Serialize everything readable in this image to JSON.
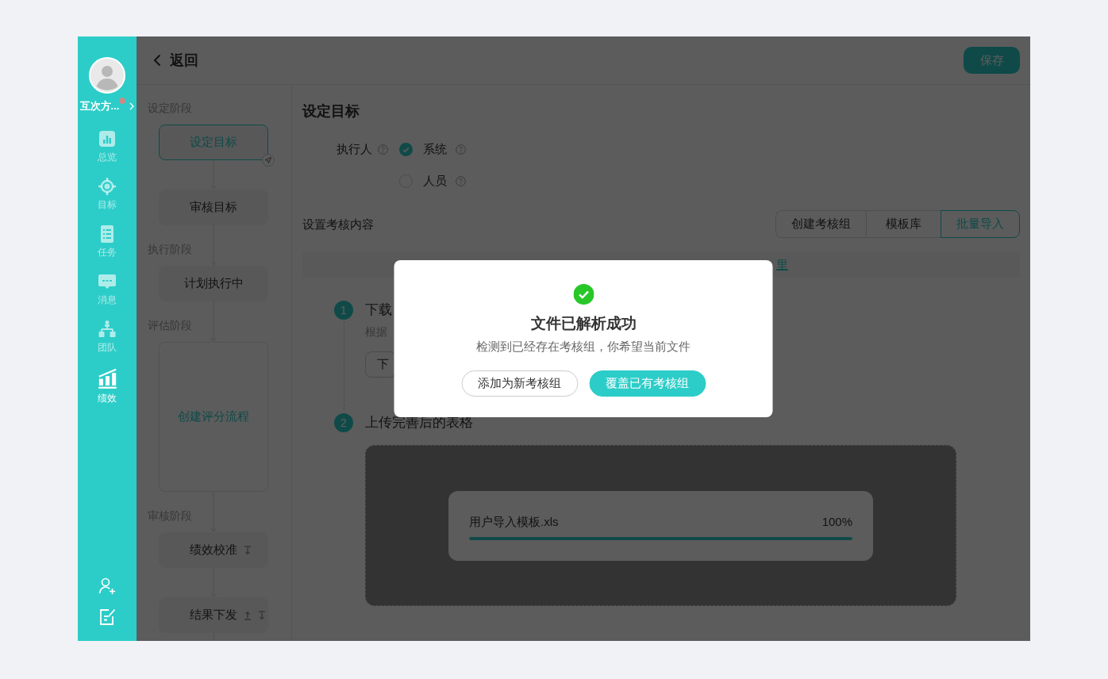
{
  "sidebar": {
    "user": {
      "name": "互次方...",
      "unread": true
    },
    "nav": [
      {
        "kind": "overview",
        "label": "总览",
        "selected": false
      },
      {
        "kind": "goals",
        "label": "目标",
        "selected": false
      },
      {
        "kind": "tasks",
        "label": "任务",
        "selected": false
      },
      {
        "kind": "messages",
        "label": "消息",
        "selected": false
      },
      {
        "kind": "team",
        "label": "团队",
        "selected": false
      },
      {
        "kind": "performance",
        "label": "绩效",
        "selected": true
      }
    ]
  },
  "header": {
    "back": "返回",
    "save": "保存"
  },
  "flow": {
    "stages": [
      {
        "label": "设定阶段",
        "steps": [
          {
            "kind": "step",
            "label": "设定目标",
            "selected": true,
            "can_move_up": false,
            "can_move_down": false
          },
          {
            "kind": "step",
            "label": "审核目标",
            "selected": false,
            "can_move_up": false,
            "can_move_down": false
          }
        ]
      },
      {
        "label": "执行阶段",
        "steps": [
          {
            "kind": "step",
            "label": "计划执行中",
            "selected": false,
            "can_move_up": false,
            "can_move_down": false
          }
        ]
      },
      {
        "label": "评估阶段",
        "steps": [
          {
            "kind": "group",
            "label": "创建评分流程",
            "selected": false
          }
        ]
      },
      {
        "label": "审核阶段",
        "steps": [
          {
            "kind": "step",
            "label": "绩效校准",
            "selected": false,
            "can_move_up": false,
            "can_move_down": true
          },
          {
            "kind": "step",
            "label": "结果下发",
            "selected": false,
            "can_move_up": true,
            "can_move_down": true
          }
        ]
      }
    ]
  },
  "content": {
    "title": "设定目标",
    "executor": {
      "label": "执行人",
      "options": [
        {
          "label": "系统",
          "selected": true
        },
        {
          "label": "人员",
          "selected": false
        }
      ]
    },
    "section_label": "设置考核内容",
    "tabs": [
      {
        "label": "创建考核组",
        "selected": false
      },
      {
        "label": "模板库",
        "selected": false
      },
      {
        "label": "批量导入",
        "selected": true
      }
    ],
    "notice": {
      "link": "里"
    },
    "steps": [
      {
        "number": "1",
        "title": "下载",
        "description": "根据",
        "button": "下"
      },
      {
        "number": "2",
        "title": "上传完善后的表格"
      }
    ],
    "upload": {
      "file_name": "用户导入模板.xls",
      "progress": "100%",
      "level": 1
    }
  },
  "dialog": {
    "title": "文件已解析成功",
    "message": "检测到已经存在考核组，你希望当前文件",
    "buttons": [
      {
        "kind": "secondary",
        "label": "添加为新考核组"
      },
      {
        "kind": "primary",
        "label": "覆盖已有考核组"
      }
    ]
  }
}
